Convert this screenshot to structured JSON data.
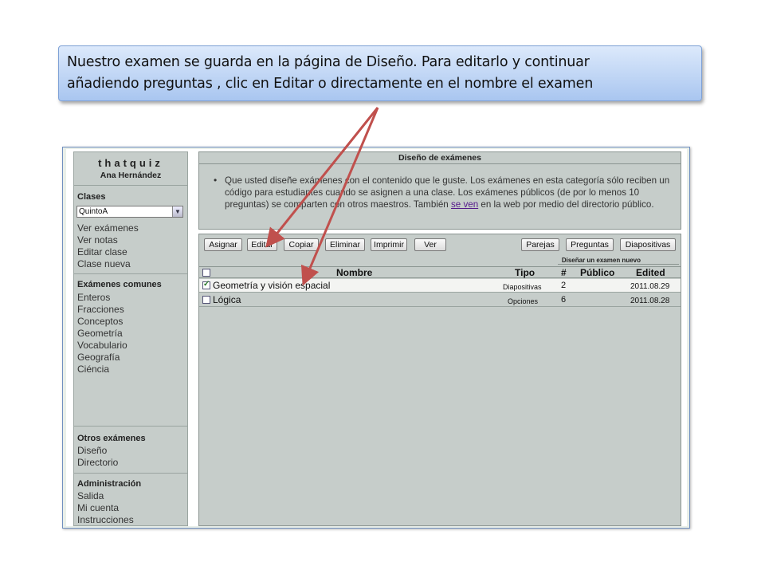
{
  "callout": {
    "line1": "Nuestro examen se guarda en la página de Diseño. Para editarlo y continuar",
    "line2": "añadiendo preguntas , clic en Editar o directamente en el nombre el examen"
  },
  "sidebar": {
    "brand": "thatquiz",
    "user": "Ana Hernández",
    "clases_title": "Clases",
    "class_select": "QuintoA",
    "clases_links": [
      "Ver exámenes",
      "Ver notas",
      "Editar clase",
      "Clase nueva"
    ],
    "comunes_title": "Exámenes comunes",
    "comunes_links": [
      "Enteros",
      "Fracciones",
      "Conceptos",
      "Geometría",
      "Vocabulario",
      "Geografía",
      "Ciéncia"
    ],
    "otros_title": "Otros exámenes",
    "otros_links": [
      "Diseño",
      "Directorio"
    ],
    "admin_title": "Administración",
    "admin_links": [
      "Salida",
      "Mi cuenta",
      "Instrucciones"
    ]
  },
  "design_panel": {
    "title": "Diseño de exámenes",
    "text_before_link": "Que usted diseñe exámenes con el contenido que le guste. Los exámenes en esta categoría sólo reciben un código para estudiantes cuando se asignen a una clase. Los exámenes públicos (de por lo menos 10 preguntas) se comparten con otros maestros. También ",
    "link": "se ven",
    "text_after_link": " en la web por medio del directorio público."
  },
  "toolbar": {
    "left_buttons": [
      "Asignar",
      "Editar",
      "Copiar",
      "Eliminar",
      "Imprimir",
      "Ver"
    ],
    "right_buttons": [
      "Parejas",
      "Preguntas",
      "Diapositivas"
    ],
    "subnote": "Diseñar un examen nuevo"
  },
  "table": {
    "headers": [
      "Nombre",
      "Tipo",
      "#",
      "Público",
      "Edited"
    ],
    "rows": [
      {
        "checked": true,
        "name": "Geometría y visión espacial",
        "tipo": "Diapositivas",
        "count": "2",
        "publico": "",
        "edited": "2011.08.29"
      },
      {
        "checked": false,
        "name": "Lógica",
        "tipo": "Opciones",
        "count": "6",
        "publico": "",
        "edited": "2011.08.28"
      }
    ]
  },
  "colors": {
    "panel_bg": "#c6cdca",
    "callout_bg": "#a9c6f0",
    "arrow": "#c0504d"
  }
}
